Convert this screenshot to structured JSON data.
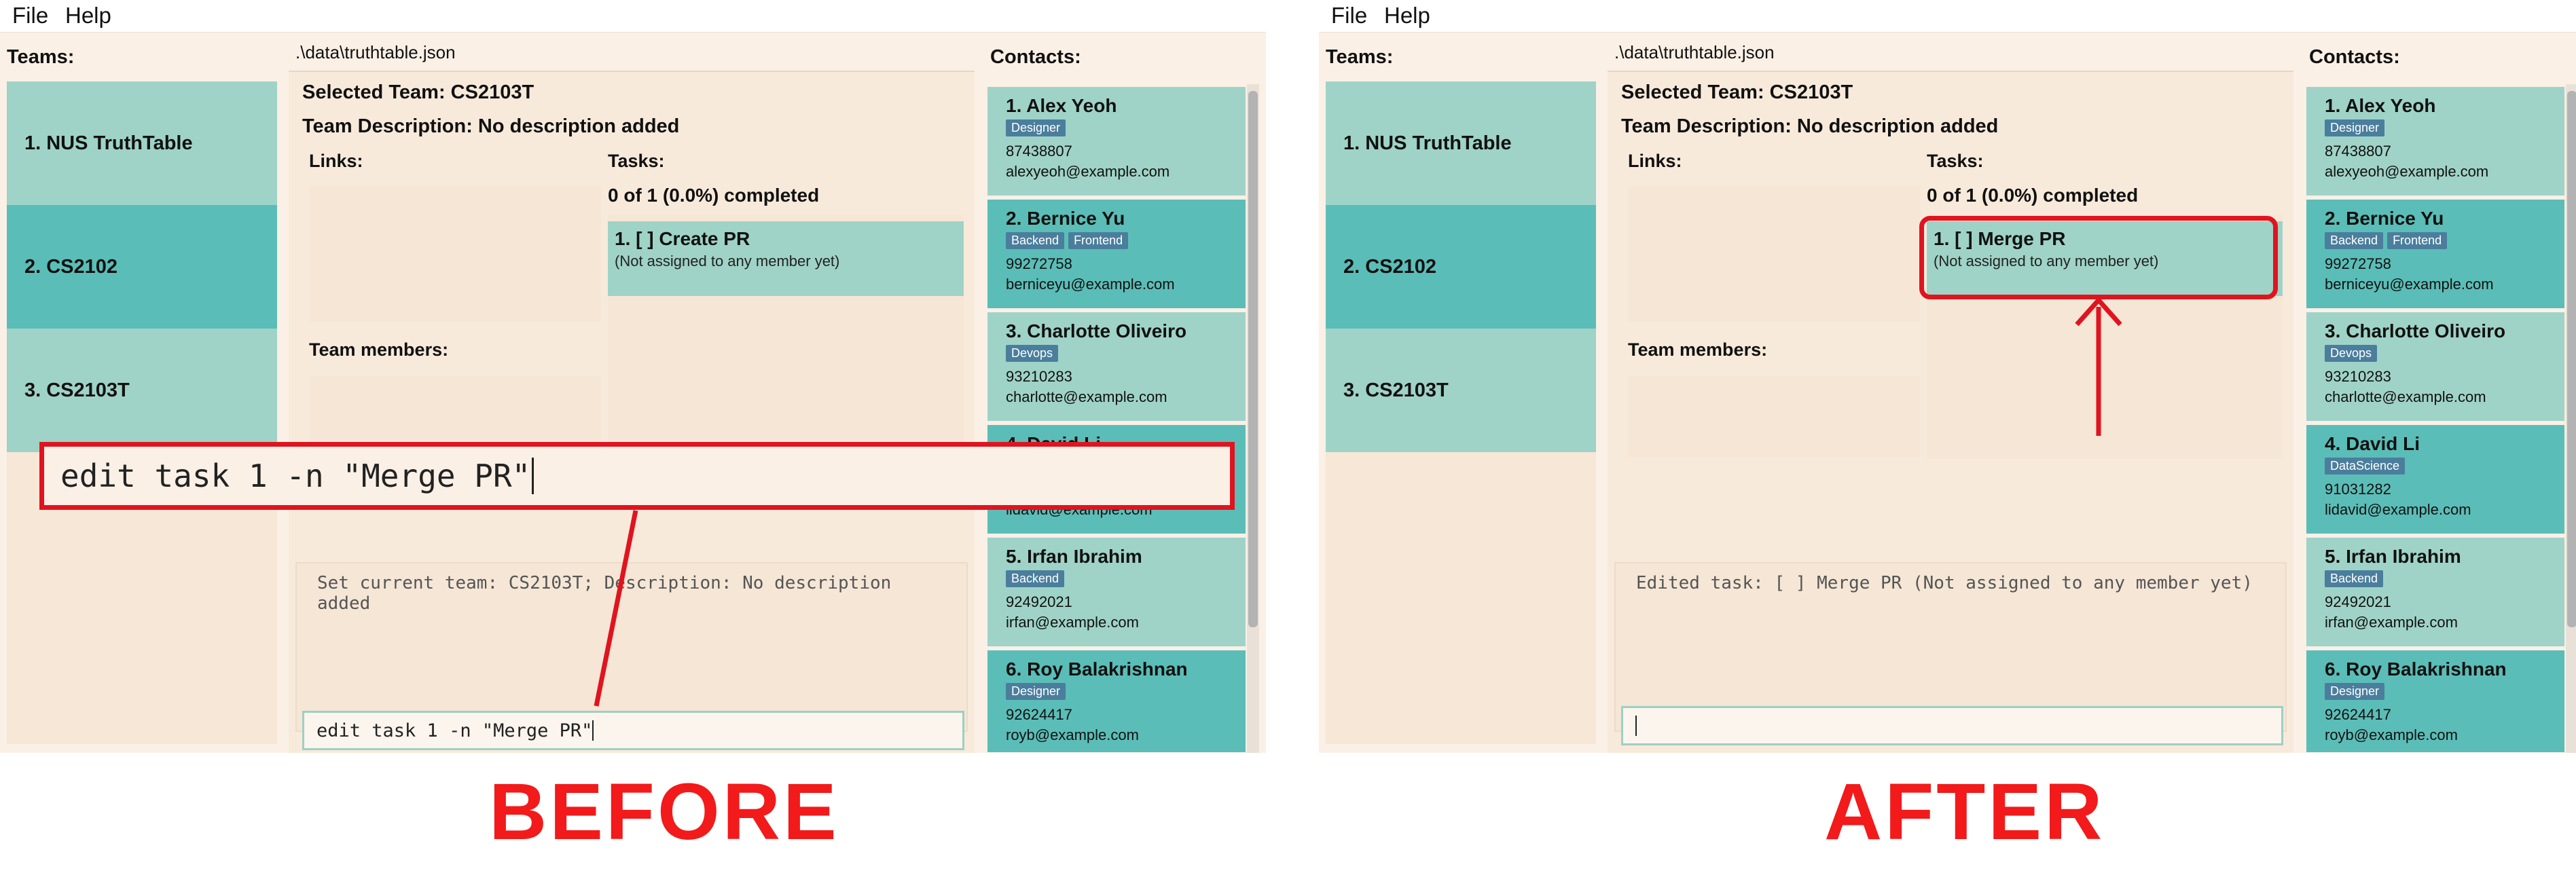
{
  "menu": {
    "file": "File",
    "help": "Help"
  },
  "headers": {
    "teams": "Teams:",
    "contacts": "Contacts:",
    "links": "Links:",
    "tasks": "Tasks:",
    "team_members": "Team members:"
  },
  "file_path": ".\\data\\truthtable.json",
  "teams": [
    {
      "label": "1. NUS TruthTable"
    },
    {
      "label": "2. CS2102"
    },
    {
      "label": "3. CS2103T"
    }
  ],
  "selected_team": "Selected Team: CS2103T",
  "team_description": "Team Description: No description added",
  "task_summary": "0 of 1 (0.0%) completed",
  "before": {
    "task_title": "1. [ ] Create PR",
    "task_sub": "(Not assigned to any member yet)",
    "result_text": "Set current team: CS2103T; Description: No description added",
    "command_text": "edit task 1 -n \"Merge PR\"",
    "big_command_text": "edit task 1 -n \"Merge PR\""
  },
  "after": {
    "task_title": "1. [ ] Merge PR",
    "task_sub": "(Not assigned to any member yet)",
    "result_text": "Edited task: [ ] Merge PR (Not assigned to any member yet)",
    "command_text": ""
  },
  "contacts": [
    {
      "name": "1. Alex Yeoh",
      "tags": [
        "Designer"
      ],
      "phone": "87438807",
      "email": "alexyeoh@example.com",
      "shade": "light"
    },
    {
      "name": "2. Bernice Yu",
      "tags": [
        "Backend",
        "Frontend"
      ],
      "phone": "99272758",
      "email": "berniceyu@example.com",
      "shade": "dark"
    },
    {
      "name": "3. Charlotte Oliveiro",
      "tags": [
        "Devops"
      ],
      "phone": "93210283",
      "email": "charlotte@example.com",
      "shade": "light"
    },
    {
      "name": "4. David Li",
      "tags": [
        "DataScience"
      ],
      "phone": "91031282",
      "email": "lidavid@example.com",
      "shade": "dark"
    },
    {
      "name": "5. Irfan Ibrahim",
      "tags": [
        "Backend"
      ],
      "phone": "92492021",
      "email": "irfan@example.com",
      "shade": "light"
    },
    {
      "name": "6. Roy Balakrishnan",
      "tags": [
        "Designer"
      ],
      "phone": "92624417",
      "email": "royb@example.com",
      "shade": "dark"
    }
  ],
  "labels": {
    "before": "BEFORE",
    "after": "AFTER"
  },
  "colors": {
    "annotation_red": "#e0141f",
    "label_red": "#f21a1a",
    "card_light": "#9fd3c7",
    "card_dark": "#5bbdb7",
    "tag": "#4a7e9c",
    "background": "#faf0e6"
  }
}
